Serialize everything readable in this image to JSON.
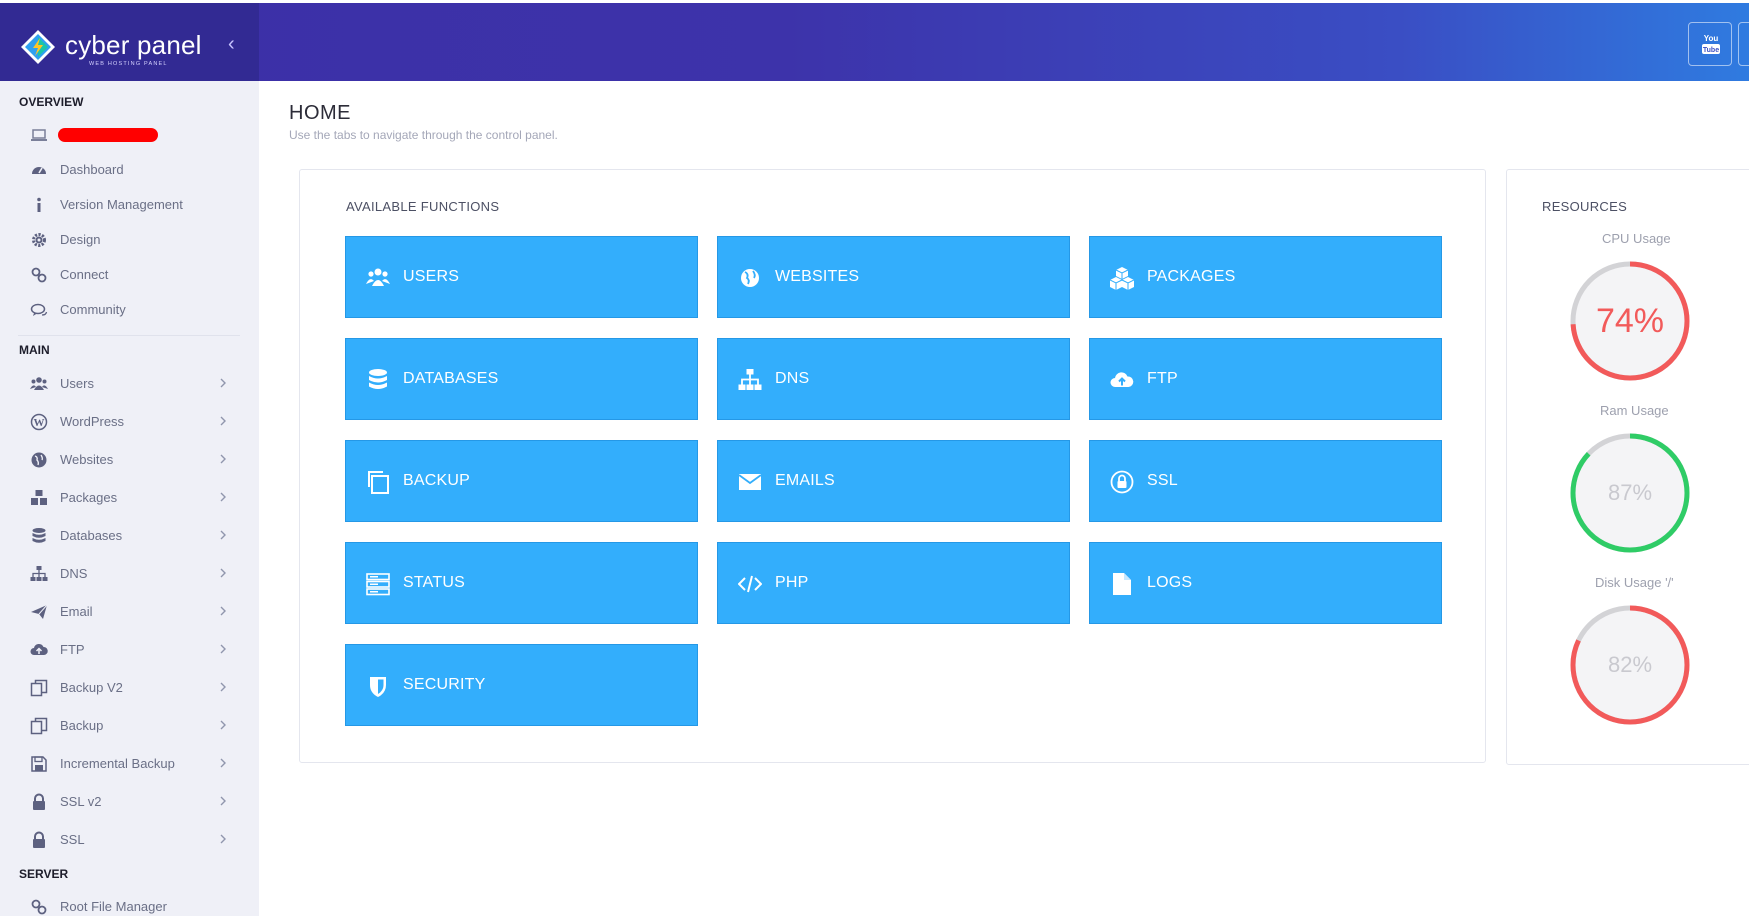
{
  "brand": {
    "name": "cyber panel",
    "tagline": "WEB HOSTING PANEL"
  },
  "header": {
    "collapse_glyph": "‹",
    "youtube_label": "You Tube",
    "colors": {
      "start": "#3c2fa6",
      "end": "#2f7be0"
    }
  },
  "sidebar": {
    "overview_title": "OVERVIEW",
    "overview_items": [
      {
        "label": "Dashboard",
        "icon": "dashboard-icon"
      },
      {
        "label": "Version Management",
        "icon": "info-icon"
      },
      {
        "label": "Design",
        "icon": "gear-icon"
      },
      {
        "label": "Connect",
        "icon": "link-icon"
      },
      {
        "label": "Community",
        "icon": "comments-icon"
      }
    ],
    "main_title": "MAIN",
    "main_items": [
      {
        "label": "Users",
        "icon": "users-icon"
      },
      {
        "label": "WordPress",
        "icon": "wordpress-icon"
      },
      {
        "label": "Websites",
        "icon": "globe-icon"
      },
      {
        "label": "Packages",
        "icon": "cubes-icon"
      },
      {
        "label": "Databases",
        "icon": "database-icon"
      },
      {
        "label": "DNS",
        "icon": "sitemap-icon"
      },
      {
        "label": "Email",
        "icon": "paper-plane-icon"
      },
      {
        "label": "FTP",
        "icon": "cloud-upload-icon"
      },
      {
        "label": "Backup V2",
        "icon": "copy-icon"
      },
      {
        "label": "Backup",
        "icon": "copy-icon"
      },
      {
        "label": "Incremental Backup",
        "icon": "save-icon"
      },
      {
        "label": "SSL v2",
        "icon": "lock-icon"
      },
      {
        "label": "SSL",
        "icon": "lock-icon"
      }
    ],
    "server_title": "SERVER",
    "server_items": [
      {
        "label": "Root File Manager",
        "icon": "link-icon"
      }
    ]
  },
  "page": {
    "title": "HOME",
    "subtitle": "Use the tabs to navigate through the control panel."
  },
  "functions": {
    "title": "AVAILABLE FUNCTIONS",
    "tile_color": "#33aefc",
    "tiles": [
      {
        "label": "USERS",
        "icon": "users-icon"
      },
      {
        "label": "WEBSITES",
        "icon": "globe-icon"
      },
      {
        "label": "PACKAGES",
        "icon": "cubes-icon"
      },
      {
        "label": "DATABASES",
        "icon": "database-icon"
      },
      {
        "label": "DNS",
        "icon": "sitemap-icon"
      },
      {
        "label": "FTP",
        "icon": "cloud-upload-icon"
      },
      {
        "label": "BACKUP",
        "icon": "copy-icon"
      },
      {
        "label": "EMAILS",
        "icon": "envelope-icon"
      },
      {
        "label": "SSL",
        "icon": "ssl-lock-icon"
      },
      {
        "label": "STATUS",
        "icon": "server-icon"
      },
      {
        "label": "PHP",
        "icon": "code-icon"
      },
      {
        "label": "LOGS",
        "icon": "file-icon"
      },
      {
        "label": "SECURITY",
        "icon": "shield-icon"
      }
    ]
  },
  "resources": {
    "title": "RESOURCES",
    "gauges": [
      {
        "label": "CPU Usage",
        "value": 74,
        "display": "74%",
        "color": "#f25a5a",
        "text_color": "#f25a5a"
      },
      {
        "label": "Ram Usage",
        "value": 87,
        "display": "87%",
        "color": "#2fcc66",
        "text_color": "#c9c9cf"
      },
      {
        "label": "Disk Usage '/'",
        "value": 82,
        "display": "82%",
        "color": "#f25a5a",
        "text_color": "#c9c9cf"
      }
    ]
  }
}
